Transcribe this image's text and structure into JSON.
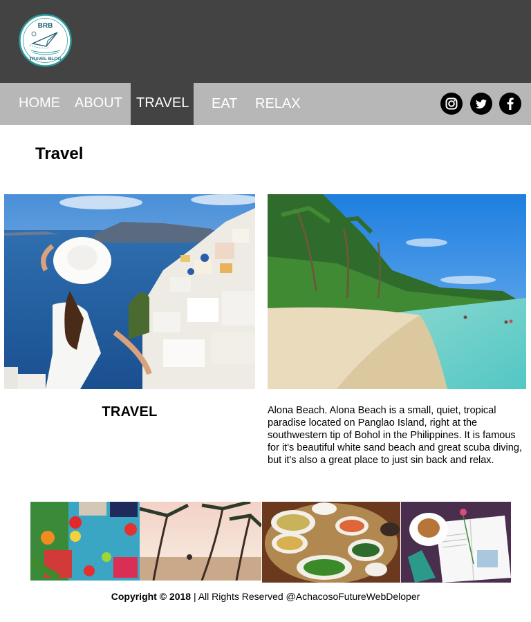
{
  "logo": {
    "top_text": "BRB",
    "bottom_text": "TRAVEL BLOG"
  },
  "nav": {
    "items": [
      {
        "label": "HOME"
      },
      {
        "label": "ABOUT"
      },
      {
        "label": "TRAVEL"
      },
      {
        "label": "EAT"
      },
      {
        "label": "RELAX"
      }
    ],
    "active": "TRAVEL"
  },
  "social": [
    {
      "name": "instagram-icon"
    },
    {
      "name": "twitter-icon"
    },
    {
      "name": "facebook-icon"
    }
  ],
  "page": {
    "title": "Travel"
  },
  "feature": {
    "caption": "TRAVEL",
    "description": "Alona Beach. Alona Beach is a small, quiet, tropical paradise located on Panglao Island, right at the southwestern tip of Bohol in the Philippines. It is famous for it's beautiful white sand beach and great scuba diving, but it's also a great place to just sin back and relax."
  },
  "footer": {
    "copyright_bold": "Copyright © 2018",
    "copyright_rest": " | All Rights Reserved @AchacosoFutureWebDeloper"
  },
  "colors": {
    "header_bg": "#434343",
    "nav_bg": "#b7b7b7",
    "logo_teal": "#2a9c9c"
  }
}
